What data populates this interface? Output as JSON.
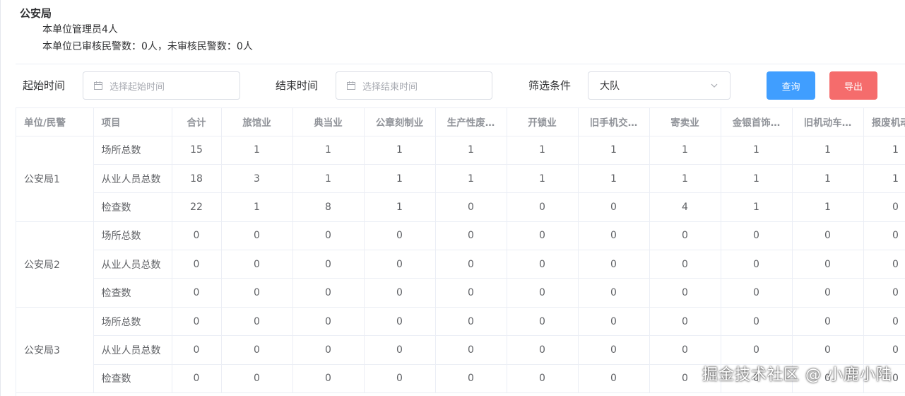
{
  "header": {
    "title": "公安局",
    "admin_count_text": "本单位管理员4人",
    "police_count_text": "本单位已审核民警数：0人，未审核民警数：0人"
  },
  "filters": {
    "start_label": "起始时间",
    "start_placeholder": "选择起始时间",
    "end_label": "结束时间",
    "end_placeholder": "选择结束时间",
    "condition_label": "筛选条件",
    "condition_value": "大队",
    "query_button": "查询",
    "export_button": "导出"
  },
  "table": {
    "columns": [
      "单位/民警",
      "项目",
      "合计",
      "旅馆业",
      "典当业",
      "公章刻制业",
      "生产性废…",
      "开锁业",
      "旧手机交…",
      "寄卖业",
      "金银首饰…",
      "旧机动车…",
      "报废机动…"
    ],
    "groups": [
      {
        "unit": "公安局1",
        "rows": [
          {
            "item": "场所总数",
            "values": [
              "15",
              "1",
              "1",
              "1",
              "1",
              "1",
              "1",
              "1",
              "1",
              "1",
              "1"
            ]
          },
          {
            "item": "从业人员总数",
            "values": [
              "18",
              "3",
              "1",
              "1",
              "1",
              "1",
              "1",
              "1",
              "1",
              "1",
              "1"
            ]
          },
          {
            "item": "检查数",
            "values": [
              "22",
              "1",
              "8",
              "1",
              "0",
              "0",
              "0",
              "4",
              "1",
              "1",
              "0"
            ]
          }
        ]
      },
      {
        "unit": "公安局2",
        "rows": [
          {
            "item": "场所总数",
            "values": [
              "0",
              "0",
              "0",
              "0",
              "0",
              "0",
              "0",
              "0",
              "0",
              "0",
              "0"
            ]
          },
          {
            "item": "从业人员总数",
            "values": [
              "0",
              "0",
              "0",
              "0",
              "0",
              "0",
              "0",
              "0",
              "0",
              "0",
              "0"
            ]
          },
          {
            "item": "检查数",
            "values": [
              "0",
              "0",
              "0",
              "0",
              "0",
              "0",
              "0",
              "0",
              "0",
              "0",
              "0"
            ]
          }
        ]
      },
      {
        "unit": "公安局3",
        "rows": [
          {
            "item": "场所总数",
            "values": [
              "0",
              "0",
              "0",
              "0",
              "0",
              "0",
              "0",
              "0",
              "0",
              "0",
              "0"
            ]
          },
          {
            "item": "从业人员总数",
            "values": [
              "0",
              "0",
              "0",
              "0",
              "0",
              "0",
              "0",
              "0",
              "0",
              "0",
              "0"
            ]
          },
          {
            "item": "检查数",
            "values": [
              "0",
              "0",
              "0",
              "0",
              "0",
              "0",
              "0",
              "0",
              "0",
              "0",
              "0"
            ]
          }
        ]
      }
    ]
  },
  "watermark": "掘金技术社区 @ 小鹿小陆",
  "icons": {
    "date_input": "calendar-icon",
    "select": "chevron-down-icon"
  },
  "colors": {
    "primary": "#409eff",
    "danger": "#f56c6c",
    "border": "#dcdfe6",
    "header_text": "#909399"
  }
}
